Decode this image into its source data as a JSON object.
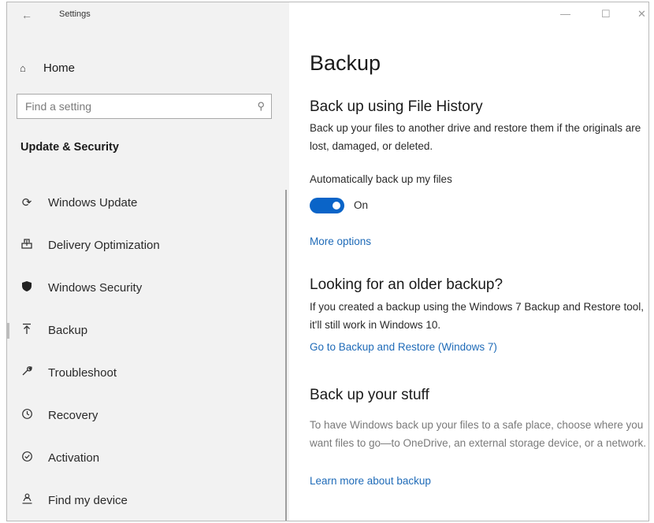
{
  "window": {
    "title": "Settings"
  },
  "sidebar": {
    "home_label": "Home",
    "search": {
      "placeholder": "Find a setting"
    },
    "section_title": "Update & Security",
    "items": [
      {
        "label": "Windows Update",
        "icon": "refresh-icon"
      },
      {
        "label": "Delivery Optimization",
        "icon": "delivery-optimization-icon"
      },
      {
        "label": "Windows Security",
        "icon": "shield-icon"
      },
      {
        "label": "Backup",
        "icon": "backup-arrow-icon",
        "selected": true
      },
      {
        "label": "Troubleshoot",
        "icon": "wrench-icon"
      },
      {
        "label": "Recovery",
        "icon": "history-icon"
      },
      {
        "label": "Activation",
        "icon": "check-circle-icon"
      },
      {
        "label": "Find my device",
        "icon": "person-location-icon"
      }
    ]
  },
  "main": {
    "title": "Backup",
    "file_history": {
      "heading": "Back up using File History",
      "description": "Back up your files to another drive and restore them if the originals are lost, damaged, or deleted.",
      "toggle_label": "Automatically back up my files",
      "toggle_state": "On",
      "toggle_on": true,
      "more_options": "More options"
    },
    "older_backup": {
      "heading": "Looking for an older backup?",
      "description": "If you created a backup using the Windows 7 Backup and Restore tool, it'll still work in Windows 10.",
      "link": "Go to Backup and Restore (Windows 7)"
    },
    "your_stuff": {
      "heading": "Back up your stuff",
      "description": "To have Windows back up your files to a safe place, choose where you want files to go—to OneDrive, an external storage device, or a network.",
      "link": "Learn more about backup"
    }
  },
  "colors": {
    "accent": "#0a64c8",
    "link": "#1f6bb8",
    "sidebar_bg": "#f2f2f2"
  }
}
